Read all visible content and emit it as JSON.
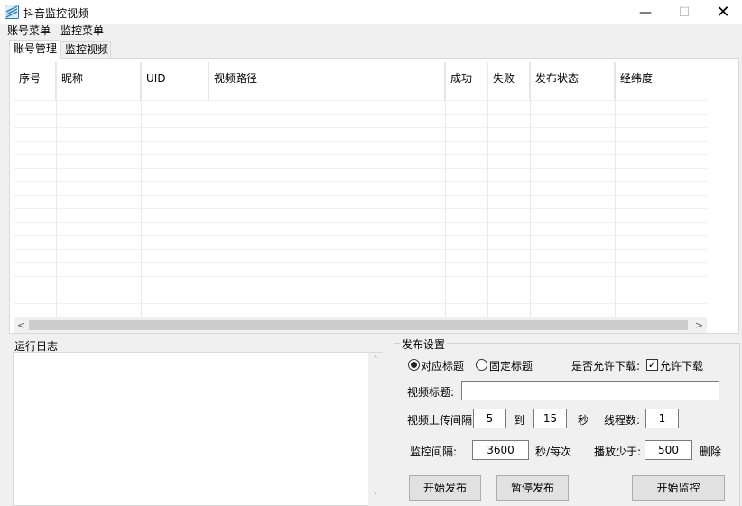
{
  "window": {
    "title": "抖音监控视频",
    "minimize_glyph": "—",
    "maximize_glyph": "☐",
    "close_glyph": "✕"
  },
  "menu": {
    "items": [
      "账号菜单",
      "监控菜单"
    ]
  },
  "tabs": [
    "账号管理",
    "监控视频"
  ],
  "grid": {
    "columns": [
      "序号",
      "昵称",
      "UID",
      "视频路径",
      "成功",
      "失败",
      "发布状态",
      "经纬度"
    ],
    "rows": []
  },
  "scrollbar": {
    "left_arrow": "<",
    "right_arrow": ">"
  },
  "log": {
    "title": "运行日志",
    "content": ""
  },
  "publish": {
    "title": "发布设置",
    "title_mode_options": [
      "对应标题",
      "固定标题"
    ],
    "title_mode_selected": "对应标题",
    "allow_download_label": "是否允许下载:",
    "allow_download_checkbox_label": "允许下载",
    "allow_download_checked": true,
    "video_title_label": "视频标题:",
    "video_title_value": "",
    "upload_interval_label": "视频上传间隔:",
    "upload_interval_min": "5",
    "upload_interval_to": "到",
    "upload_interval_max": "15",
    "upload_interval_unit": "秒",
    "threads_label": "线程数:",
    "threads_value": "1",
    "monitor_interval_label": "监控间隔:",
    "monitor_interval_value": "3600",
    "monitor_interval_unit": "秒/每次",
    "play_less_than_label": "播放少于:",
    "play_less_than_value": "500",
    "delete_label": "删除",
    "start_publish_button": "开始发布",
    "pause_publish_button": "暂停发布",
    "start_monitor_button": "开始监控"
  }
}
